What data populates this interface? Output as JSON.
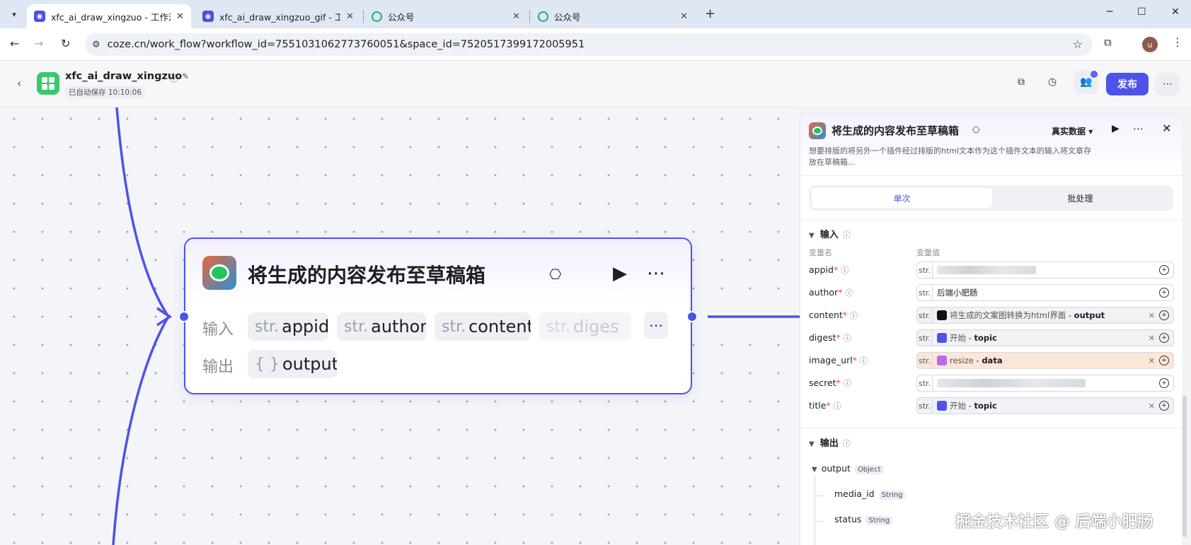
{
  "browser": {
    "tabs": [
      {
        "title": "xfc_ai_draw_xingzuo - 工作流",
        "icon": "coze-icon",
        "active": true
      },
      {
        "title": "xfc_ai_draw_xingzuo_gif - 工作",
        "icon": "coze-icon",
        "active": false
      },
      {
        "title": "公众号",
        "icon": "wechat-mp-icon",
        "active": false
      },
      {
        "title": "公众号",
        "icon": "wechat-mp-icon",
        "active": false
      }
    ],
    "url": "coze.cn/work_flow?workflow_id=7551031062773760051&space_id=7520517399172005951",
    "profile_initial": "u"
  },
  "header": {
    "workflow_name": "xfc_ai_draw_xingzuo",
    "autosave": "已自动保存 10:10:06",
    "publish_label": "发布",
    "accent": "#4d53e8"
  },
  "node": {
    "title": "将生成的内容发布至草稿箱",
    "input_label": "输入",
    "output_label": "输出",
    "inputs": [
      {
        "type": "str.",
        "name": "appid"
      },
      {
        "type": "str.",
        "name": "author"
      },
      {
        "type": "str.",
        "name": "content"
      },
      {
        "type": "str.",
        "name": "diges"
      }
    ],
    "output": {
      "type": "{ }",
      "name": "output"
    }
  },
  "panel": {
    "title": "将生成的内容发布至草稿箱",
    "data_mode": "真实数据",
    "description": "想要排版的将另外一个插件经过排版的html文本作为这个插件文本的输入将文章存放在草稿箱…",
    "tabs": [
      "单次",
      "批处理"
    ],
    "input_section": "输入",
    "col_name": "变量名",
    "col_value": "变量值",
    "output_section": "输出",
    "vars": [
      {
        "name": "appid",
        "type": "str.",
        "kind": "blur"
      },
      {
        "name": "author",
        "type": "str.",
        "kind": "text",
        "value": "后端小肥肠"
      },
      {
        "name": "content",
        "type": "str.",
        "kind": "ref",
        "src": "将生成的文案图转换为html界面",
        "field": "output",
        "icon": "dark"
      },
      {
        "name": "digest",
        "type": "str.",
        "kind": "ref",
        "src": "开始",
        "field": "topic",
        "icon": "blue"
      },
      {
        "name": "image_url",
        "type": "str.",
        "kind": "ref",
        "src": "resize",
        "field": "data",
        "icon": "purple"
      },
      {
        "name": "secret",
        "type": "str.",
        "kind": "blur"
      },
      {
        "name": "title",
        "type": "str.",
        "kind": "ref",
        "src": "开始",
        "field": "topic",
        "icon": "blue"
      }
    ],
    "outputs": {
      "name": "output",
      "type": "Object",
      "children": [
        {
          "name": "media_id",
          "type": "String"
        },
        {
          "name": "status",
          "type": "String"
        }
      ]
    }
  },
  "watermark": "掘金技术社区 @ 后端小肥肠"
}
